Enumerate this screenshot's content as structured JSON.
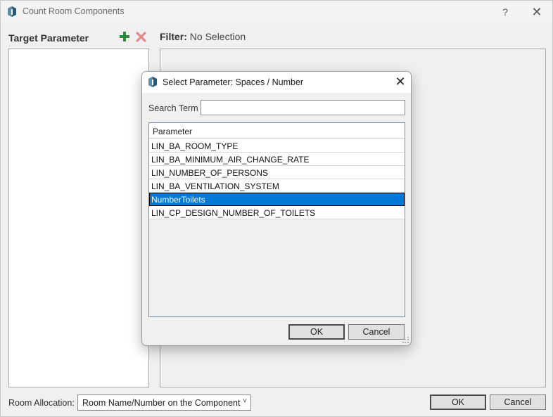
{
  "window": {
    "title": "Count Room Components",
    "help_glyph": "?",
    "close_glyph": "✕"
  },
  "target_parameter": {
    "label": "Target Parameter",
    "add_icon": "plus-icon",
    "remove_icon": "x-icon",
    "add_color": "#2e8b3e",
    "remove_color": "#e08a8a"
  },
  "filter": {
    "label": "Filter:",
    "value": "No Selection"
  },
  "room_allocation": {
    "label": "Room Allocation:",
    "selected": "Room Name/Number on the Component",
    "chevron": "˅"
  },
  "footer": {
    "ok_label": "OK",
    "cancel_label": "Cancel"
  },
  "dialog": {
    "title": "Select Parameter: Spaces / Number",
    "close_glyph": "✕",
    "search_label": "Search Term",
    "search_value": "",
    "column_header": "Parameter",
    "rows": [
      "LIN_BA_ROOM_TYPE",
      "LIN_BA_MINIMUM_AIR_CHANGE_RATE",
      "LIN_NUMBER_OF_PERSONS",
      "LIN_BA_VENTILATION_SYSTEM",
      "NumberToilets",
      "LIN_CP_DESIGN_NUMBER_OF_TOILETS"
    ],
    "selected_row": "NumberToilets",
    "selection_color": "#0078d7",
    "ok_label": "OK",
    "cancel_label": "Cancel"
  }
}
